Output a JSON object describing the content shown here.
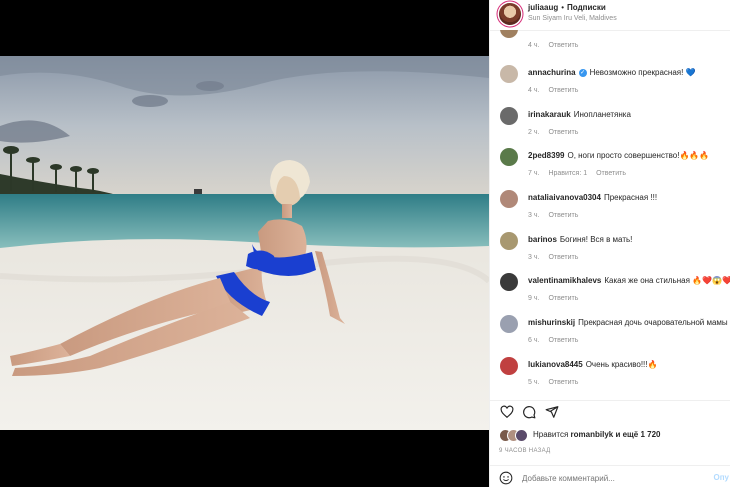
{
  "header": {
    "username": "juliaaug",
    "separator": "•",
    "follow_label": "Подписки",
    "location": "Sun Siyam Iru Veli, Maldives"
  },
  "comments": [
    {
      "user": "",
      "text": "",
      "time": "4 ч.",
      "reply": "Ответить",
      "likes": "",
      "avatar_color": "#a08060",
      "verified": false
    },
    {
      "user": "annachurina",
      "text": "Невозможно прекрасная! 💙",
      "time": "4 ч.",
      "reply": "Ответить",
      "likes": "",
      "avatar_color": "#c8b8a8",
      "verified": true
    },
    {
      "user": "irinakarauk",
      "text": "Инопланетянка",
      "time": "2 ч.",
      "reply": "Ответить",
      "likes": "",
      "avatar_color": "#6a6a6a",
      "verified": false
    },
    {
      "user": "2ped8399",
      "text": "О, ноги просто совершенство!🔥🔥🔥",
      "time": "7 ч.",
      "reply": "Ответить",
      "likes": "Нравится: 1",
      "avatar_color": "#5a7a4a",
      "verified": false
    },
    {
      "user": "nataliaivanova0304",
      "text": "Прекрасная !!!",
      "time": "3 ч.",
      "reply": "Ответить",
      "likes": "",
      "avatar_color": "#b08878",
      "verified": false
    },
    {
      "user": "barinos",
      "text": "Богиня! Вся в мать!",
      "time": "3 ч.",
      "reply": "Ответить",
      "likes": "",
      "avatar_color": "#a89870",
      "verified": false
    },
    {
      "user": "valentinamikhalevs",
      "text": "Какая же она стильная 🔥❤️😱❤️",
      "time": "9 ч.",
      "reply": "Ответить",
      "likes": "",
      "avatar_color": "#3a3a3a",
      "verified": false
    },
    {
      "user": "mishurinskij",
      "text": "Прекрасная дочь очаровательной мамы 👏",
      "time": "6 ч.",
      "reply": "Ответить",
      "likes": "",
      "avatar_color": "#9aa0b0",
      "verified": false
    },
    {
      "user": "lukianova8445",
      "text": "Очень красиво!!!🔥",
      "time": "5 ч.",
      "reply": "Ответить",
      "likes": "",
      "avatar_color": "#c04040",
      "verified": false
    }
  ],
  "likes": {
    "prefix": "Нравится",
    "liker": "romanbilyk",
    "suffix": "и ещё 1 720"
  },
  "timeago": "9 ЧАСОВ НАЗАД",
  "add_comment": {
    "placeholder": "Добавьте комментарий...",
    "post_label": "Опу"
  },
  "icons": {
    "like": "heart-icon",
    "comment": "comment-icon",
    "share": "share-icon",
    "emoji": "emoji-icon"
  }
}
